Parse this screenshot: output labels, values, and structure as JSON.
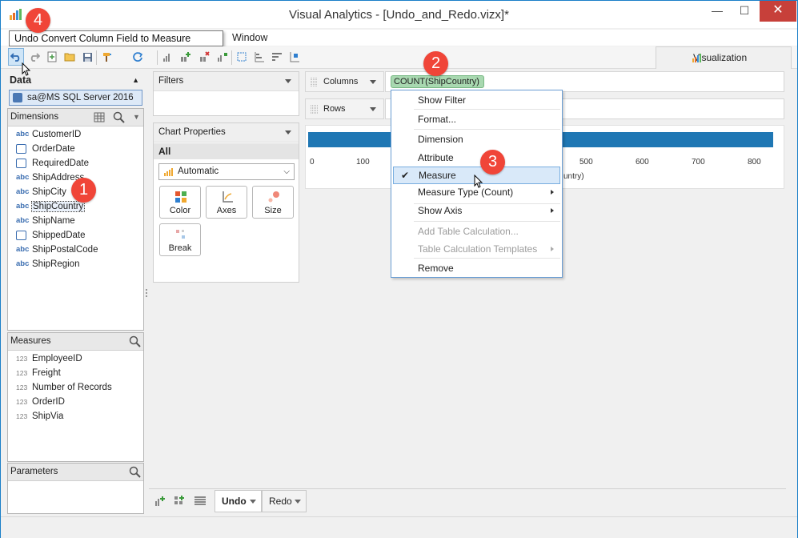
{
  "window": {
    "title": "Visual Analytics - [Undo_and_Redo.vizx]*",
    "minimize_glyph": "—",
    "maximize_glyph": "☐",
    "close_glyph": "✕"
  },
  "tooltip": "Undo Convert Column Field to Measure (Ctrl+Z)",
  "menu": {
    "window": "Window"
  },
  "toolbar": {
    "icons": [
      "undo-icon",
      "redo-icon",
      "new-icon",
      "open-icon",
      "save-icon",
      "paint-icon",
      "refresh-icon",
      "chart-icon",
      "add-chart-icon",
      "delete-chart-icon",
      "select-icon",
      "bar-icon",
      "sort-icon",
      "tree-icon"
    ]
  },
  "viz_tab": {
    "label": "Visualization"
  },
  "data_panel": {
    "heading": "Data",
    "connection": "sa@MS SQL Server 2016 ..."
  },
  "dimensions": {
    "heading": "Dimensions",
    "items": [
      {
        "type": "abc",
        "name": "CustomerID"
      },
      {
        "type": "date",
        "name": "OrderDate"
      },
      {
        "type": "date",
        "name": "RequiredDate"
      },
      {
        "type": "abc",
        "name": "ShipAddress"
      },
      {
        "type": "abc",
        "name": "ShipCity"
      },
      {
        "type": "abc",
        "name": "ShipCountry"
      },
      {
        "type": "abc",
        "name": "ShipName"
      },
      {
        "type": "date",
        "name": "ShippedDate"
      },
      {
        "type": "abc",
        "name": "ShipPostalCode"
      },
      {
        "type": "abc",
        "name": "ShipRegion"
      }
    ]
  },
  "measures": {
    "heading": "Measures",
    "items": [
      {
        "type": "123",
        "name": "EmployeeID"
      },
      {
        "type": "123",
        "name": "Freight"
      },
      {
        "type": "123",
        "name": "Number of Records"
      },
      {
        "type": "123",
        "name": "OrderID"
      },
      {
        "type": "123",
        "name": "ShipVia"
      }
    ]
  },
  "parameters": {
    "heading": "Parameters"
  },
  "filters": {
    "heading": "Filters"
  },
  "chart_properties": {
    "heading": "Chart Properties",
    "all_label": "All",
    "chart_type": "Automatic",
    "cards": [
      "Color",
      "Axes",
      "Size",
      "Break"
    ]
  },
  "shelves": {
    "columns": "Columns",
    "rows": "Rows",
    "columns_pill": "COUNT(ShipCountry)"
  },
  "chart": {
    "ticks": [
      "0",
      "100",
      "500",
      "600",
      "700",
      "800"
    ],
    "axis_title_fragment": "untry)"
  },
  "context_menu": {
    "items": [
      {
        "label": "Show Filter",
        "disabled": false
      },
      {
        "label": "Format...",
        "disabled": false
      },
      {
        "label": "Dimension",
        "disabled": false
      },
      {
        "label": "Attribute",
        "disabled": false
      },
      {
        "label": "Measure",
        "disabled": false,
        "checked": true,
        "highlighted": true
      },
      {
        "label": "Measure Type (Count)",
        "disabled": false,
        "submenu": true
      },
      {
        "label": "Show Axis",
        "disabled": false,
        "submenu": true
      },
      {
        "label": "Add Table Calculation...",
        "disabled": true
      },
      {
        "label": "Table Calculation Templates",
        "disabled": true,
        "submenu": true
      },
      {
        "label": "Remove",
        "disabled": false
      }
    ],
    "check_glyph": "✔"
  },
  "callouts": [
    "1",
    "2",
    "3",
    "4"
  ],
  "bottom_tabs": [
    "Undo",
    "Redo"
  ],
  "colors": {
    "accent": "#1a7fc8",
    "bar": "#1f77b4",
    "callout": "#f04538",
    "pill": "#a8d8b0"
  }
}
